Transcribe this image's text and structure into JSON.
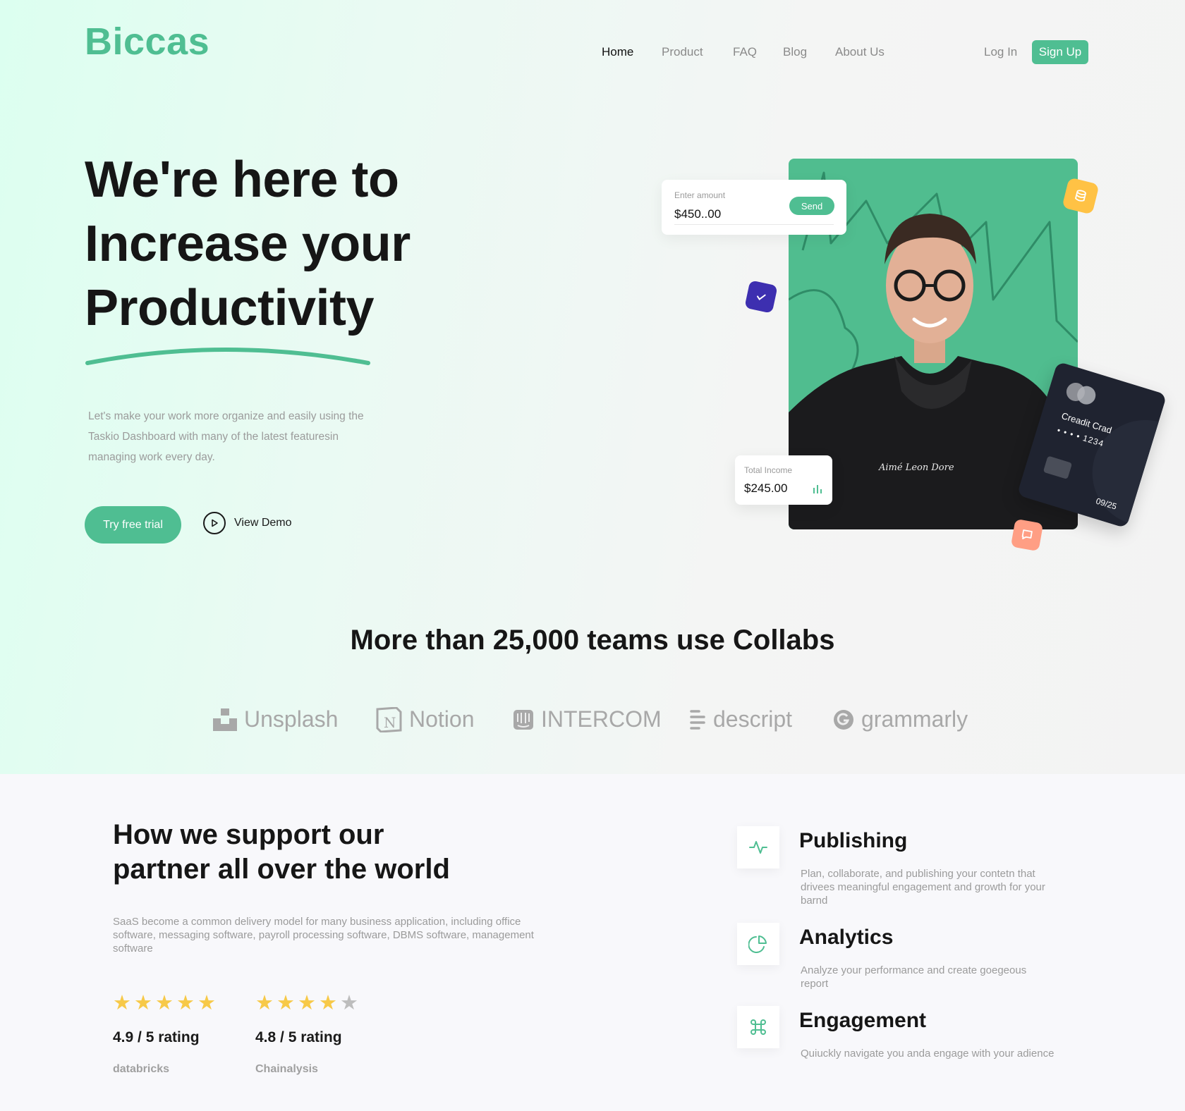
{
  "brand": {
    "logo": "Biccas",
    "accent_color": "#4fbe92"
  },
  "nav": {
    "items": [
      {
        "label": "Home",
        "active": true
      },
      {
        "label": "Product",
        "active": false
      },
      {
        "label": "FAQ",
        "active": false
      },
      {
        "label": "Blog",
        "active": false
      },
      {
        "label": "About Us",
        "active": false
      }
    ],
    "login": "Log In",
    "signup": "Sign Up"
  },
  "hero": {
    "headline": [
      "We're here to",
      "Increase your",
      "Productivity"
    ],
    "subtext": "Let's make your work more organize and easily using the Taskio Dashboard with many of the latest featuresin managing work every day.",
    "cta_primary": "Try free trial",
    "cta_secondary": "View Demo",
    "cta_secondary_icon": "play-icon"
  },
  "widgets": {
    "amount": {
      "label": "Enter amount",
      "value": "$450..00",
      "button": "Send"
    },
    "income": {
      "label": "Total Income",
      "value": "$245.00",
      "icon": "bar-chart-icon"
    },
    "credit_card": {
      "label": "Creadit Crad",
      "digits": "• • • •  1234",
      "expiry": "09/25"
    },
    "badges": [
      {
        "icon": "check-icon",
        "color": "#3d2fb0"
      },
      {
        "icon": "coins-icon",
        "color": "#ffc245"
      },
      {
        "icon": "chat-icon",
        "color": "#ff9e84"
      }
    ]
  },
  "teams": {
    "title": "More than 25,000 teams use Collabs",
    "partners": [
      {
        "name": "Unsplash",
        "icon": "unsplash-logo-icon"
      },
      {
        "name": "Notion",
        "icon": "notion-logo-icon"
      },
      {
        "name": "INTERCOM",
        "icon": "intercom-logo-icon"
      },
      {
        "name": "descript",
        "icon": "descript-logo-icon"
      },
      {
        "name": "grammarly",
        "icon": "grammarly-logo-icon"
      }
    ]
  },
  "support": {
    "title": [
      "How we support our",
      "partner all over the world"
    ],
    "text": "SaaS become a common delivery model for many business application, including office software, messaging software, payroll processing software, DBMS software, management software",
    "ratings": [
      {
        "stars": 5,
        "value": "4.9 / 5 rating",
        "source": "databricks"
      },
      {
        "stars": 4,
        "value": "4.8 / 5 rating",
        "source": "Chainalysis"
      }
    ],
    "features": [
      {
        "title": "Publishing",
        "icon": "activity-icon",
        "desc": "Plan, collaborate, and publishing your contetn that drivees meaningful engagement and growth for your barnd"
      },
      {
        "title": "Analytics",
        "icon": "pie-chart-icon",
        "desc": "Analyze your performance and create goegeous report"
      },
      {
        "title": "Engagement",
        "icon": "command-icon",
        "desc": "Quiuckly navigate you anda engage with your adience"
      }
    ]
  }
}
